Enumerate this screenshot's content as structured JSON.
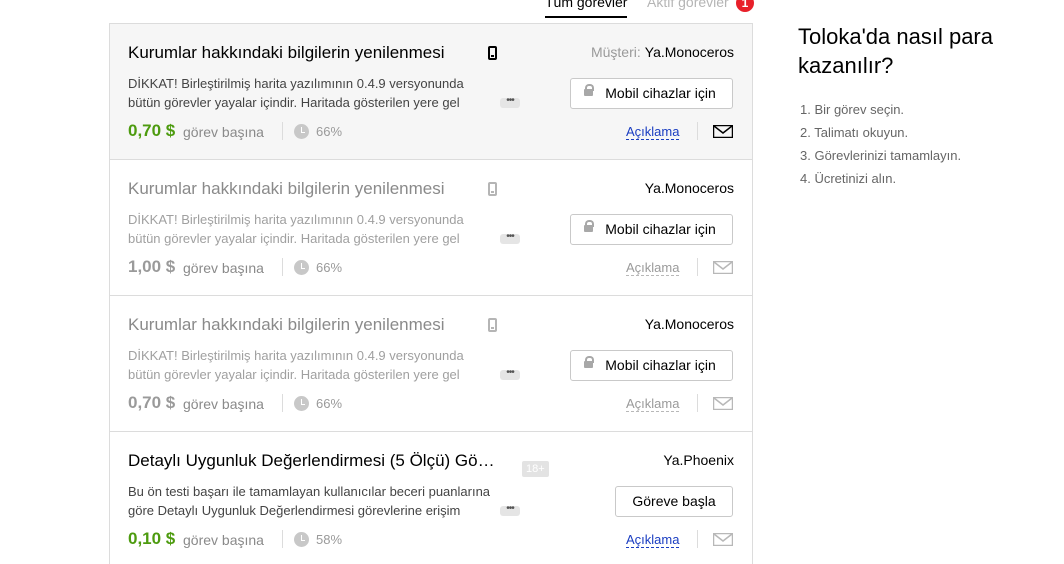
{
  "tabs": {
    "all": "Tüm görevler",
    "active": "Aktif görevler",
    "active_count": "1"
  },
  "tasks": [
    {
      "title": "Kurumlar hakkındaki bilgilerin yenilenmesi",
      "customer_label": "Müşteri:",
      "customer": "Ya.Monoceros",
      "desc_line1": "DİKKAT! Birleştirilmiş harita yazılımının 0.4.9 versyonunda",
      "desc_line2": "bütün görevler yayalar içindir. Haritada gösterilen yere gel",
      "button": "Mobil cihazlar için",
      "price": "0,70 $",
      "per": "görev başına",
      "percent": "66%",
      "desc_link": "Açıklama",
      "mail_color": "#000000"
    },
    {
      "title": "Kurumlar hakkındaki bilgilerin yenilenmesi",
      "customer": "Ya.Monoceros",
      "desc_line1": "DİKKAT! Birleştirilmiş harita yazılımının 0.4.9 versyonunda",
      "desc_line2": "bütün görevler yayalar içindir. Haritada gösterilen yere gel",
      "button": "Mobil cihazlar için",
      "price": "1,00 $",
      "per": "görev başına",
      "percent": "66%",
      "desc_link": "Açıklama",
      "mail_color": "#b8b8b8"
    },
    {
      "title": "Kurumlar hakkındaki bilgilerin yenilenmesi",
      "customer": "Ya.Monoceros",
      "desc_line1": "DİKKAT! Birleştirilmiş harita yazılımının 0.4.9 versyonunda",
      "desc_line2": "bütün görevler yayalar içindir. Haritada gösterilen yere gel",
      "button": "Mobil cihazlar için",
      "price": "0,70 $",
      "per": "görev başına",
      "percent": "66%",
      "desc_link": "Açıklama",
      "mail_color": "#b8b8b8"
    },
    {
      "title": "Detaylı Uygunluk Değerlendirmesi (5 Ölçü) Gö…",
      "age_badge": "18+",
      "customer": "Ya.Phoenix",
      "desc_line1": "Bu ön testi başarı ile tamamlayan kullanıcılar beceri puanlarına",
      "desc_line2": "göre Detaylı Uygunluk Değerlendirmesi görevlerine erişim",
      "button": "Göreve başla",
      "price": "0,10 $",
      "per": "görev başına",
      "percent": "58%",
      "desc_link": "Açıklama",
      "mail_color": "#b8b8b8"
    }
  ],
  "sidebar": {
    "title": "Toloka'da nasıl para kazanılır?",
    "steps": [
      "1. Bir görev seçin.",
      "2. Talimatı okuyun.",
      "3. Görevlerinizi tamamlayın.",
      "4. Ücretinizi alın."
    ]
  },
  "colors": {
    "price_green": "#4d9b0f",
    "link_blue": "#1a3dc1",
    "badge_red": "#e8202a"
  }
}
